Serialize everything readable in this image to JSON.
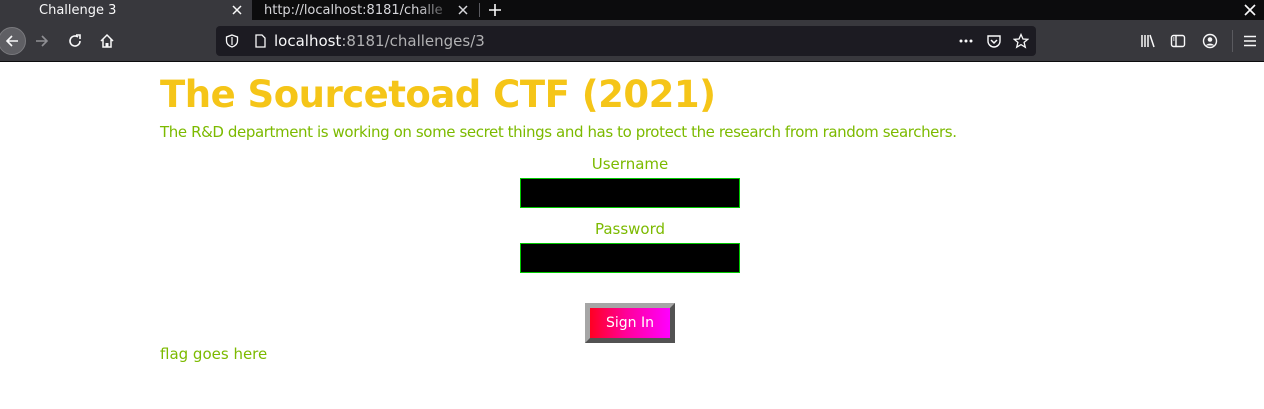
{
  "browser": {
    "tabs": [
      {
        "title": "Challenge 3"
      },
      {
        "title": "http://localhost:8181/challe"
      }
    ],
    "url": {
      "host": "localhost",
      "rest": ":8181/challenges/3"
    },
    "icons": [
      "back-icon",
      "forward-icon",
      "reload-icon",
      "home-icon",
      "shield-icon",
      "page-icon",
      "more-icon",
      "pocket-icon",
      "star-icon",
      "library-icon",
      "sidebar-icon",
      "account-icon",
      "menu-icon",
      "new-tab-icon",
      "close-icon"
    ],
    "chrome_colors": {
      "tabbar": "#0c0c0d",
      "toolbar": "#38383d",
      "urlbar": "#1c1b22"
    }
  },
  "page": {
    "title": "The Sourcetoad CTF (2021)",
    "description": "The R&D department is working on some secret things and has to protect the research from random searchers.",
    "form": {
      "username_label": "Username",
      "username_value": "",
      "password_label": "Password",
      "password_value": "",
      "signin_label": "Sign In"
    },
    "flag_text": "flag goes here",
    "colors": {
      "title": "#f5c518",
      "text": "#7cba00",
      "field_bg": "#000000",
      "field_border": "#00c800"
    }
  }
}
